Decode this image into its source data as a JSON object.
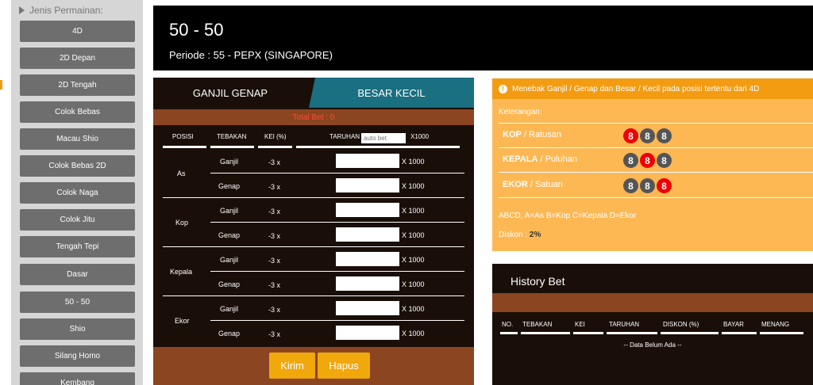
{
  "sidebar": {
    "heading": "Jenis Permainan:",
    "items": [
      "4D",
      "2D Depan",
      "2D Tengah",
      "Colok Bebas",
      "Macau Shio",
      "Colok Bebas 2D",
      "Colok Naga",
      "Colok Jitu",
      "Tengah Tepi",
      "Dasar",
      "50 - 50",
      "Shio",
      "Silang Homo",
      "Kembang"
    ]
  },
  "header": {
    "title": "50 - 50",
    "periode": "Periode : 55 - PEPX (SINGAPORE)"
  },
  "bet": {
    "tabs": [
      "GANJIL GENAP",
      "BESAR KECIL"
    ],
    "total_bet": "Total Bet : 0",
    "columns": {
      "posisi": "POSISI",
      "tebakan": "TEBAKAN",
      "kei": "KEI (%)",
      "taruhan": "TARUHAN",
      "x1000": "X1000"
    },
    "auto_bet_placeholder": "auto bet",
    "groups": [
      {
        "posisi": "As",
        "rows": [
          {
            "tebakan": "Ganjil",
            "kei": "-3 x",
            "mult": "X 1000"
          },
          {
            "tebakan": "Genap",
            "kei": "-3 x",
            "mult": "X 1000"
          }
        ]
      },
      {
        "posisi": "Kop",
        "rows": [
          {
            "tebakan": "Ganjil",
            "kei": "-3 x",
            "mult": "X 1000"
          },
          {
            "tebakan": "Genap",
            "kei": "-3 x",
            "mult": "X 1000"
          }
        ]
      },
      {
        "posisi": "Kepala",
        "rows": [
          {
            "tebakan": "Ganjil",
            "kei": "-3 x",
            "mult": "X 1000"
          },
          {
            "tebakan": "Genap",
            "kei": "-3 x",
            "mult": "X 1000"
          }
        ]
      },
      {
        "posisi": "Ekor",
        "rows": [
          {
            "tebakan": "Ganjil",
            "kei": "-3 x",
            "mult": "X 1000"
          },
          {
            "tebakan": "Genap",
            "kei": "-3 x",
            "mult": "X 1000"
          }
        ]
      }
    ],
    "kirim": "Kirim",
    "hapus": "Hapus"
  },
  "info": {
    "notice": "Menebak Ganjil / Genap dan Besar / Kecil pada posisi tertentu dari 4D",
    "keterangan": "Keterangan:",
    "positions": [
      {
        "bold": "KOP",
        "rest": " / Ratusan",
        "balls": [
          "8",
          "8",
          "8"
        ],
        "highlight": 0
      },
      {
        "bold": "KEPALA",
        "rest": " / Puluhan",
        "balls": [
          "8",
          "8",
          "8"
        ],
        "highlight": 1
      },
      {
        "bold": "EKOR",
        "rest": " / Satuan",
        "balls": [
          "8",
          "8",
          "8"
        ],
        "highlight": 2
      }
    ],
    "legend": "ABCD, A=As B=Kop C=Kepala D=Ekor",
    "diskon_label": "Diskon :",
    "diskon_value": "2%"
  },
  "history": {
    "title": "History Bet",
    "columns": [
      "NO.",
      "TEBAKAN",
      "KEI",
      "TARUHAN",
      "DISKON (%)",
      "BAYAR",
      "MENANG"
    ],
    "empty": "-- Data Belum Ada --"
  },
  "colors": {
    "accent": "#f39c12",
    "panel": "#1a0f08",
    "rust": "#8b4520",
    "teal": "#1a6f80",
    "button": "#f0a80c"
  }
}
